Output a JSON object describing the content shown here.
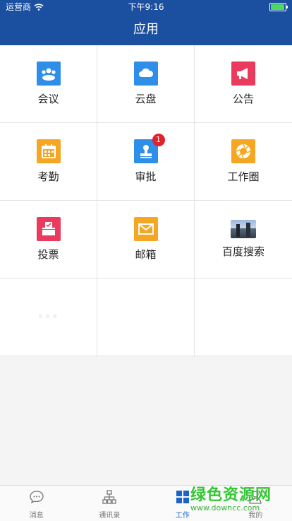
{
  "status_bar": {
    "carrier": "运营商",
    "time": "下午9:16",
    "battery_level": 0.95
  },
  "header": {
    "title": "应用"
  },
  "apps": [
    {
      "label": "会议",
      "icon": "meeting-icon",
      "color": "#2f8ee8"
    },
    {
      "label": "云盘",
      "icon": "cloud-icon",
      "color": "#2f8ee8"
    },
    {
      "label": "公告",
      "icon": "megaphone-icon",
      "color": "#ea3b5f"
    },
    {
      "label": "考勤",
      "icon": "calendar-icon",
      "color": "#f5a623"
    },
    {
      "label": "审批",
      "icon": "stamp-icon",
      "color": "#2f8ee8",
      "badge": "1"
    },
    {
      "label": "工作圈",
      "icon": "aperture-icon",
      "color": "#f5a623"
    },
    {
      "label": "投票",
      "icon": "ballot-box-icon",
      "color": "#ea3b5f"
    },
    {
      "label": "邮箱",
      "icon": "mail-icon",
      "color": "#f5a623"
    },
    {
      "label": "百度搜索",
      "icon": "baidu-photo-icon"
    },
    {
      "label": "◦◦◦",
      "icon": "more-icon"
    }
  ],
  "tabs": [
    {
      "label": "消息",
      "icon": "chat-bubble-icon",
      "active": false
    },
    {
      "label": "通讯录",
      "icon": "org-chart-icon",
      "active": false
    },
    {
      "label": "工作",
      "icon": "grid-icon",
      "active": true
    },
    {
      "label": "我的",
      "icon": "user-icon",
      "active": false
    }
  ],
  "watermark": {
    "title": "绿色资源网",
    "url": "www.downcc.com"
  }
}
